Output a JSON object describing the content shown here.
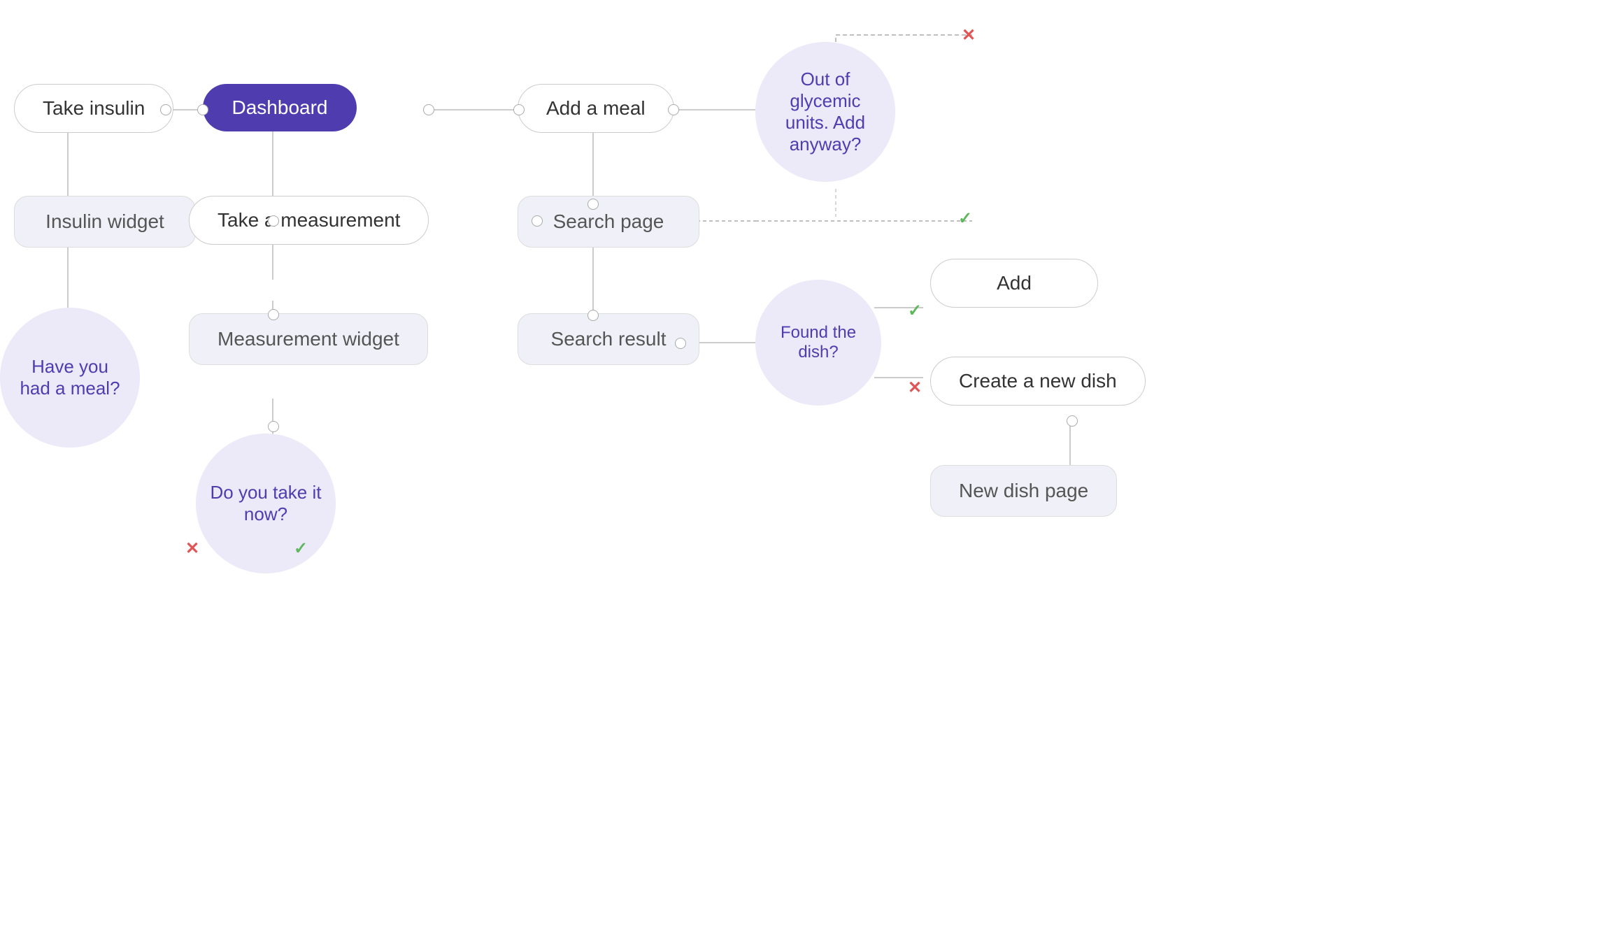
{
  "nodes": {
    "take_insulin": {
      "label": "Take insulin"
    },
    "dashboard": {
      "label": "Dashboard"
    },
    "add_meal": {
      "label": "Add a meal"
    },
    "out_glycemic": {
      "label": "Out of glycemic units. Add anyway?"
    },
    "insulin_widget": {
      "label": "Insulin widget"
    },
    "take_measurement": {
      "label": "Take a measurement"
    },
    "search_page": {
      "label": "Search page"
    },
    "have_meal": {
      "label": "Have you had a meal?"
    },
    "measurement_widget": {
      "label": "Measurement widget"
    },
    "search_result": {
      "label": "Search result"
    },
    "found_dish": {
      "label": "Found the dish?"
    },
    "add": {
      "label": "Add"
    },
    "create_new_dish": {
      "label": "Create a new dish"
    },
    "do_you_take": {
      "label": "Do you take it now?"
    },
    "new_dish_page": {
      "label": "New dish page"
    }
  },
  "icons": {
    "close": "✕",
    "check": "✓"
  }
}
